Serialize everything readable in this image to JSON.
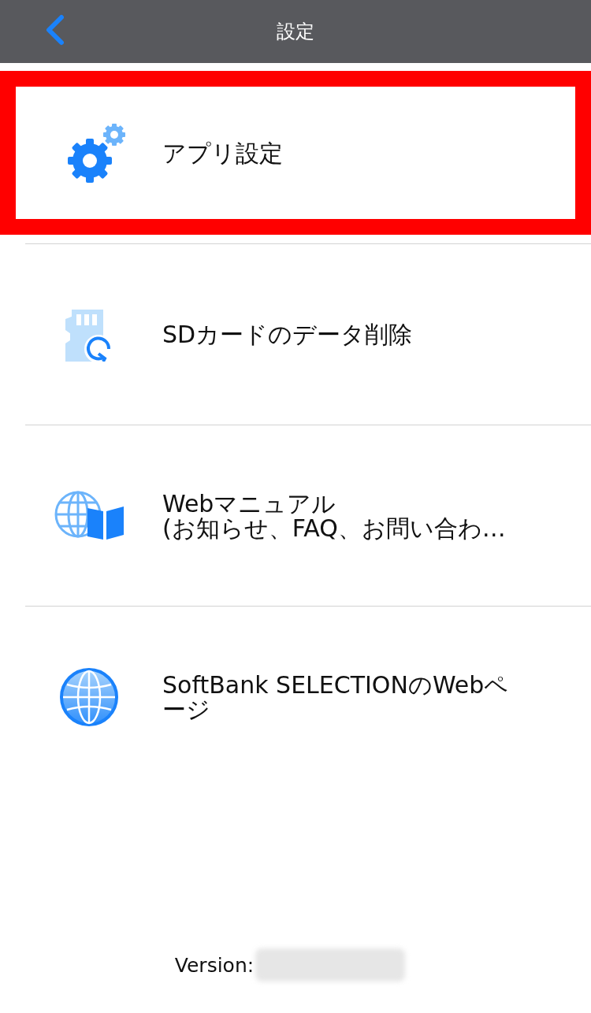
{
  "header": {
    "title": "設定"
  },
  "items": [
    {
      "kind": "gear",
      "lines": [
        "アプリ設定"
      ],
      "highlighted": true
    },
    {
      "kind": "sd-card",
      "lines": [
        "SDカードのデータ削除"
      ],
      "highlighted": false
    },
    {
      "kind": "manual",
      "lines": [
        "Webマニュアル",
        "(お知らせ、FAQ、お問い合わ…"
      ],
      "highlighted": false
    },
    {
      "kind": "globe",
      "lines": [
        "SoftBank SELECTIONのWebページ"
      ],
      "highlighted": false
    }
  ],
  "footer": {
    "label": "Version:"
  }
}
